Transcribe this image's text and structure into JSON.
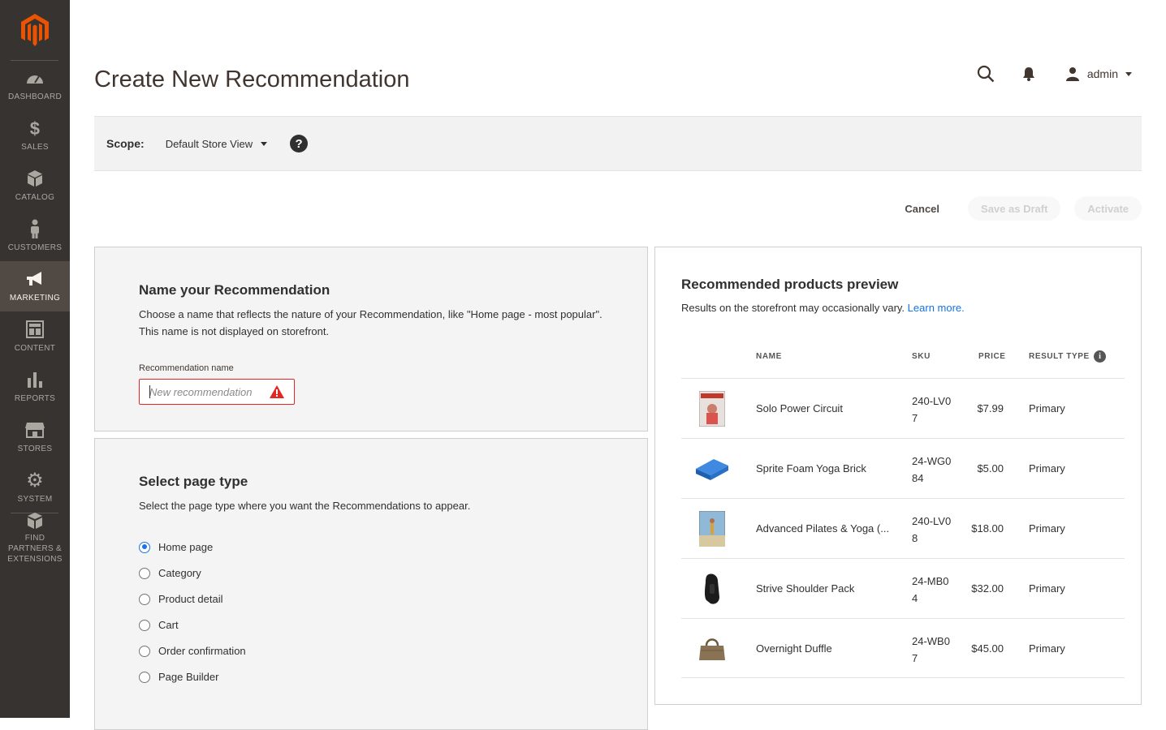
{
  "sidebar": {
    "logo": "magento-logo",
    "items": [
      {
        "label": "DASHBOARD",
        "icon": "dashboard-icon"
      },
      {
        "label": "SALES",
        "icon": "dollar-icon"
      },
      {
        "label": "CATALOG",
        "icon": "cube-icon"
      },
      {
        "label": "CUSTOMERS",
        "icon": "person-icon"
      },
      {
        "label": "MARKETING",
        "icon": "megaphone-icon",
        "active": true
      },
      {
        "label": "CONTENT",
        "icon": "layout-icon"
      },
      {
        "label": "REPORTS",
        "icon": "bar-chart-icon"
      },
      {
        "label": "STORES",
        "icon": "store-icon"
      },
      {
        "label": "SYSTEM",
        "icon": "gear-icon"
      },
      {
        "label": "FIND PARTNERS & EXTENSIONS",
        "icon": "boxes-icon"
      }
    ]
  },
  "header": {
    "title": "Create New Recommendation",
    "user": "admin"
  },
  "scope": {
    "label": "Scope:",
    "value": "Default Store View"
  },
  "actions": {
    "cancel": "Cancel",
    "save_draft": "Save as Draft",
    "activate": "Activate"
  },
  "name_panel": {
    "title": "Name your Recommendation",
    "desc1": "Choose a name that reflects the nature of your Recommendation, like \"Home page - most popular\".",
    "desc2": "This name is not displayed on storefront.",
    "field_label": "Recommendation name",
    "placeholder": "New recommendation"
  },
  "page_type_panel": {
    "title": "Select page type",
    "desc": "Select the page type where you want the Recommendations to appear.",
    "options": [
      "Home page",
      "Category",
      "Product detail",
      "Cart",
      "Order confirmation",
      "Page Builder"
    ],
    "selected": "Home page"
  },
  "preview": {
    "title": "Recommended products preview",
    "sub": "Results on the storefront may occasionally vary.",
    "learn_more": "Learn more.",
    "columns": [
      "NAME",
      "SKU",
      "PRICE",
      "RESULT TYPE"
    ],
    "rows": [
      {
        "name": "Solo Power Circuit",
        "sku": "240-LV07",
        "price": "$7.99",
        "type": "Primary",
        "thumb": "dvd-cover-red"
      },
      {
        "name": "Sprite Foam Yoga Brick",
        "sku": "24-WG084",
        "price": "$5.00",
        "type": "Primary",
        "thumb": "blue-yoga-brick"
      },
      {
        "name": "Advanced Pilates & Yoga (...",
        "sku": "240-LV08",
        "price": "$18.00",
        "type": "Primary",
        "thumb": "dvd-cover-beach"
      },
      {
        "name": "Strive Shoulder Pack",
        "sku": "24-MB04",
        "price": "$32.00",
        "type": "Primary",
        "thumb": "black-backpack"
      },
      {
        "name": "Overnight Duffle",
        "sku": "24-WB07",
        "price": "$45.00",
        "type": "Primary",
        "thumb": "brown-duffle-bag"
      }
    ]
  },
  "colors": {
    "sidebar_bg": "#373330",
    "sidebar_active": "#514943",
    "brand": "#eb5202",
    "error": "#e22626",
    "link": "#1473e6",
    "radio_selected": "#1a73e8"
  }
}
